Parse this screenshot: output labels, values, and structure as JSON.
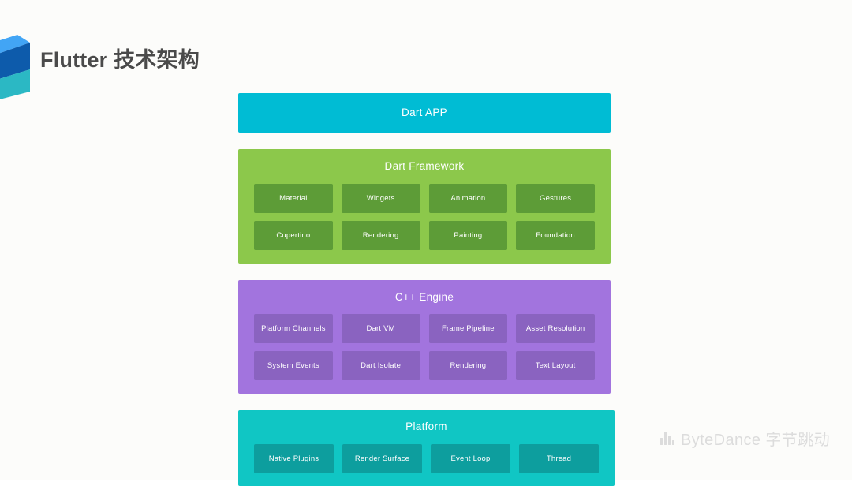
{
  "slide": {
    "title": "Flutter 技术架构",
    "background_color": "#fcfcfa",
    "title_color": "#4a4a4a"
  },
  "logo": {
    "name": "flutter-logo",
    "colors": [
      "#42a5f5",
      "#0d5bab",
      "#1565c0",
      "#2bb8c4",
      "#27c0cd"
    ]
  },
  "diagram": {
    "type": "layered-architecture",
    "layers": [
      {
        "name": "dart-app",
        "title": "Dart APP",
        "band_color": "#00bcd4",
        "cell_color": "",
        "cells": []
      },
      {
        "name": "dart-framework",
        "title": "Dart Framework",
        "band_color": "#8cc84b",
        "cell_color": "#5d9c37",
        "cells": [
          "Material",
          "Widgets",
          "Animation",
          "Gestures",
          "Cupertino",
          "Rendering",
          "Painting",
          "Foundation"
        ]
      },
      {
        "name": "cpp-engine",
        "title": "C++ Engine",
        "band_color": "#a274de",
        "cell_color": "#8a63c0",
        "cells": [
          "Platform Channels",
          "Dart VM",
          "Frame Pipeline",
          "Asset Resolution",
          "System Events",
          "Dart Isolate",
          "Rendering",
          "Text Layout"
        ]
      },
      {
        "name": "platform",
        "title": "Platform",
        "band_color": "#10c6c4",
        "cell_color": "#0d9e9e",
        "cells": [
          "Native Plugins",
          "Render Surface",
          "Event Loop",
          "Thread"
        ]
      }
    ]
  },
  "watermark": {
    "icon": "bar-chart-icon",
    "text": "ByteDance 字节跳动",
    "color": "#dcdcdc"
  }
}
